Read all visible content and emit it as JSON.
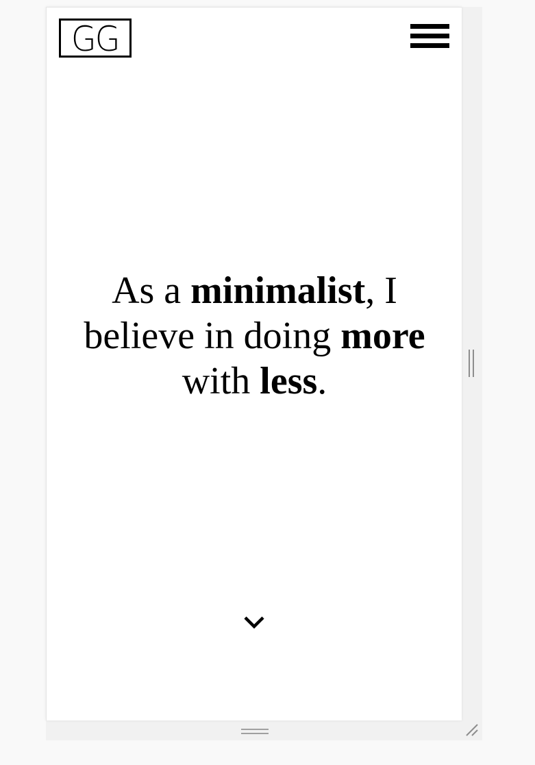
{
  "header": {
    "logo_text": "GG",
    "menu_icon": "hamburger-menu-icon"
  },
  "hero": {
    "line1_a": "As a ",
    "line1_bold": "minimalist",
    "line1_b": ", I",
    "line2_a": "believe in doing ",
    "line2_bold": "more",
    "line3_a": "with ",
    "line3_bold": "less",
    "line3_b": ".",
    "scroll_icon": "chevron-down-icon"
  },
  "frame": {
    "vertical_resize_icon": "vertical-resize-handle-icon",
    "horizontal_resize_icon": "horizontal-resize-handle-icon",
    "corner_resize_icon": "corner-resize-handle-icon"
  },
  "colors": {
    "text": "#000000",
    "background": "#ffffff",
    "frame": "#f1f1f1"
  }
}
